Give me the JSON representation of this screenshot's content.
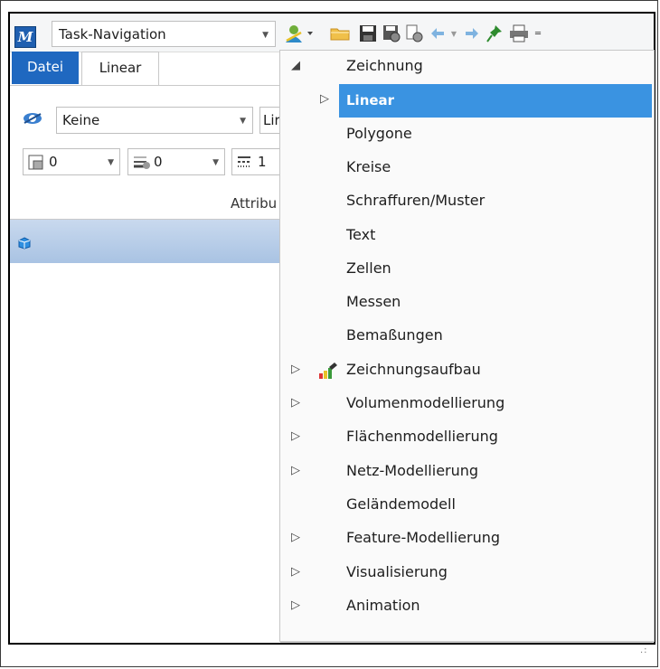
{
  "quick_access": {
    "app_logo_text": "M",
    "task_navigation": "Task-Navigation"
  },
  "ribbon": {
    "tabs": [
      {
        "label": "Datei",
        "active": false
      },
      {
        "label": "Linear",
        "active": true
      }
    ],
    "level": "Keine",
    "line_style": "Lir",
    "attributes": [
      {
        "icon": "color-icon",
        "value": "0"
      },
      {
        "icon": "line-weight-icon",
        "value": "0"
      },
      {
        "icon": "line-style-icon",
        "value": "1"
      }
    ],
    "group_label": "Attribu"
  },
  "menu": {
    "items": [
      {
        "label": "Zeichnung",
        "expander": "◢",
        "selected": false
      },
      {
        "label": "Linear",
        "expander": "▷",
        "selected": true
      },
      {
        "label": "Polygone",
        "expander": "",
        "selected": false
      },
      {
        "label": "Kreise",
        "expander": "",
        "selected": false
      },
      {
        "label": "Schraffuren/Muster",
        "expander": "",
        "selected": false
      },
      {
        "label": "Text",
        "expander": "",
        "selected": false
      },
      {
        "label": "Zellen",
        "expander": "",
        "selected": false
      },
      {
        "label": "Messen",
        "expander": "",
        "selected": false
      },
      {
        "label": "Bemaßungen",
        "expander": "",
        "selected": false
      },
      {
        "label": "Zeichnungsaufbau",
        "expander": "▷",
        "selected": false,
        "icon": "drawing-setup-icon"
      },
      {
        "label": "Volumenmodellierung",
        "expander": "▷",
        "selected": false
      },
      {
        "label": "Flächenmodellierung",
        "expander": "▷",
        "selected": false
      },
      {
        "label": "Netz-Modellierung",
        "expander": "▷",
        "selected": false
      },
      {
        "label": "Geländemodell",
        "expander": "",
        "selected": false
      },
      {
        "label": "Feature-Modellierung",
        "expander": "▷",
        "selected": false
      },
      {
        "label": "Visualisierung",
        "expander": "▷",
        "selected": false
      },
      {
        "label": "Animation",
        "expander": "▷",
        "selected": false
      }
    ]
  },
  "colors": {
    "accent": "#1f68c0",
    "selection": "#3a93e1"
  }
}
